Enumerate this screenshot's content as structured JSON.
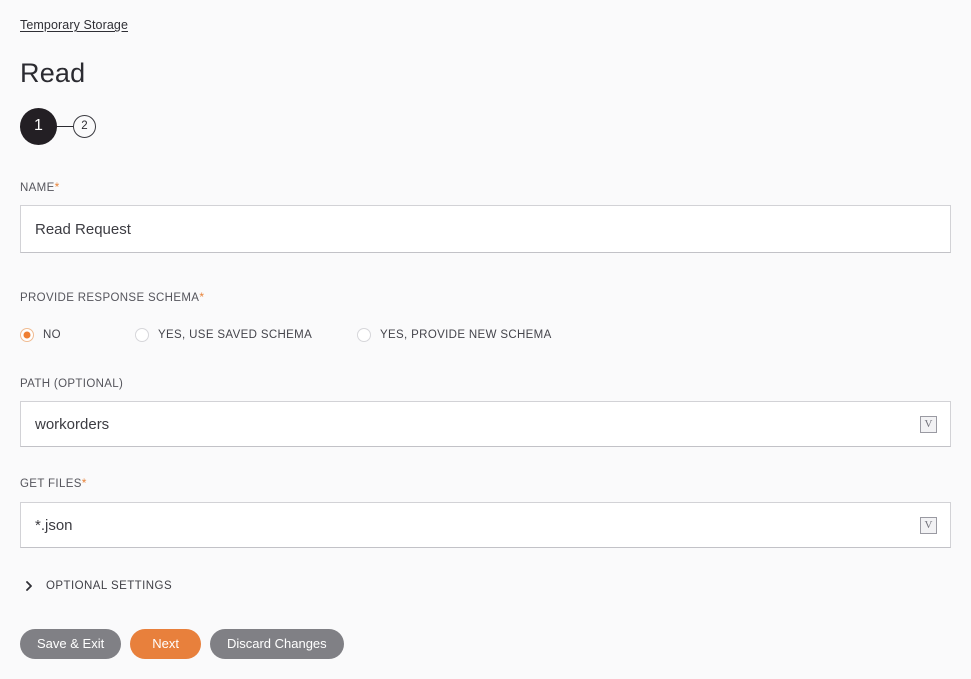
{
  "breadcrumb": {
    "label": "Temporary Storage"
  },
  "header": {
    "title": "Read"
  },
  "stepper": {
    "steps": [
      {
        "number": "1",
        "state": "current"
      },
      {
        "number": "2",
        "state": "upcoming"
      }
    ]
  },
  "form": {
    "name": {
      "label": "NAME",
      "required": "*",
      "value": "Read Request",
      "placeholder": ""
    },
    "provide_response_schema": {
      "label": "PROVIDE RESPONSE SCHEMA",
      "required": "*",
      "options": [
        {
          "label": "NO",
          "selected": true
        },
        {
          "label": "YES, USE SAVED SCHEMA",
          "selected": false
        },
        {
          "label": "YES, PROVIDE NEW SCHEMA",
          "selected": false
        }
      ]
    },
    "path": {
      "label": "PATH (OPTIONAL)",
      "required": "",
      "value": "workorders",
      "placeholder": "",
      "variable_button": "V"
    },
    "get_files": {
      "label": "GET FILES",
      "required": "*",
      "value": "*.json",
      "placeholder": "",
      "variable_button": "V"
    }
  },
  "optional_settings": {
    "label": "OPTIONAL SETTINGS",
    "icon": "chevron-right-icon",
    "expanded": false
  },
  "buttons": [
    {
      "label": "Save & Exit",
      "style": "grey"
    },
    {
      "label": "Next",
      "style": "orange"
    },
    {
      "label": "Discard Changes",
      "style": "grey"
    }
  ],
  "colors": {
    "accent": "#ef7f33",
    "button_orange": "#e8803c",
    "button_grey": "#808085",
    "page_background": "#fafafb",
    "step_active": "#231f24",
    "required_asterisk": "#e8833a"
  }
}
